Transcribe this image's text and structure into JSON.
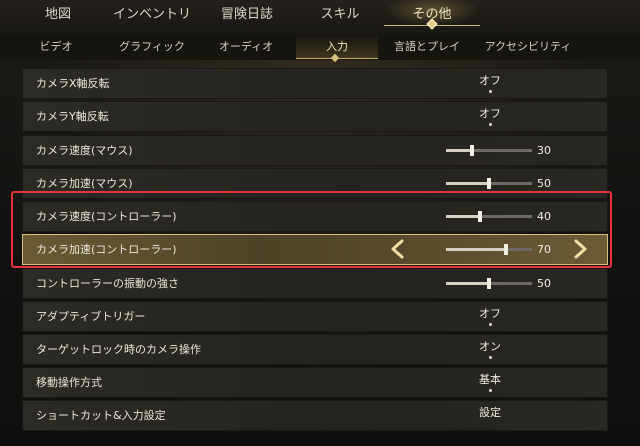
{
  "top_tabs": [
    {
      "label": "地図"
    },
    {
      "label": "インベントリ"
    },
    {
      "label": "冒険日誌"
    },
    {
      "label": "スキル"
    },
    {
      "label": "その他"
    }
  ],
  "sub_tabs": [
    {
      "label": "ビデオ"
    },
    {
      "label": "グラフィック"
    },
    {
      "label": "オーディオ"
    },
    {
      "label": "入力"
    },
    {
      "label": "言語とプレイ"
    },
    {
      "label": "アクセシビリティ"
    }
  ],
  "active_top_tab": "その他",
  "active_sub_tab": "入力",
  "settings": [
    {
      "label": "カメラX軸反転",
      "value": "オフ"
    },
    {
      "label": "カメラY軸反転",
      "value": "オフ"
    },
    {
      "label": "カメラ速度(マウス)",
      "value": "30",
      "level": 0.3
    },
    {
      "label": "カメラ加速(マウス)",
      "value": "50",
      "level": 0.5
    },
    {
      "label": "カメラ速度(コントローラー)",
      "value": "40",
      "level": 0.4
    },
    {
      "label": "カメラ加速(コントローラー)",
      "value": "70",
      "level": 0.7,
      "selected": true
    },
    {
      "label": "コントローラーの振動の強さ",
      "value": "50",
      "level": 0.5
    },
    {
      "label": "アダプティブトリガー",
      "value": "オフ"
    },
    {
      "label": "ターゲットロック時のカメラ操作",
      "value": "オン"
    },
    {
      "label": "移動操作方式",
      "value": "基本"
    },
    {
      "label": "ショートカット&入力設定",
      "value": "設定"
    }
  ],
  "colors": {
    "accent_gold": "#d7c080",
    "highlight_red": "#e6333a"
  },
  "icons": {
    "left": "chevron-left-icon",
    "right": "chevron-right-icon"
  }
}
